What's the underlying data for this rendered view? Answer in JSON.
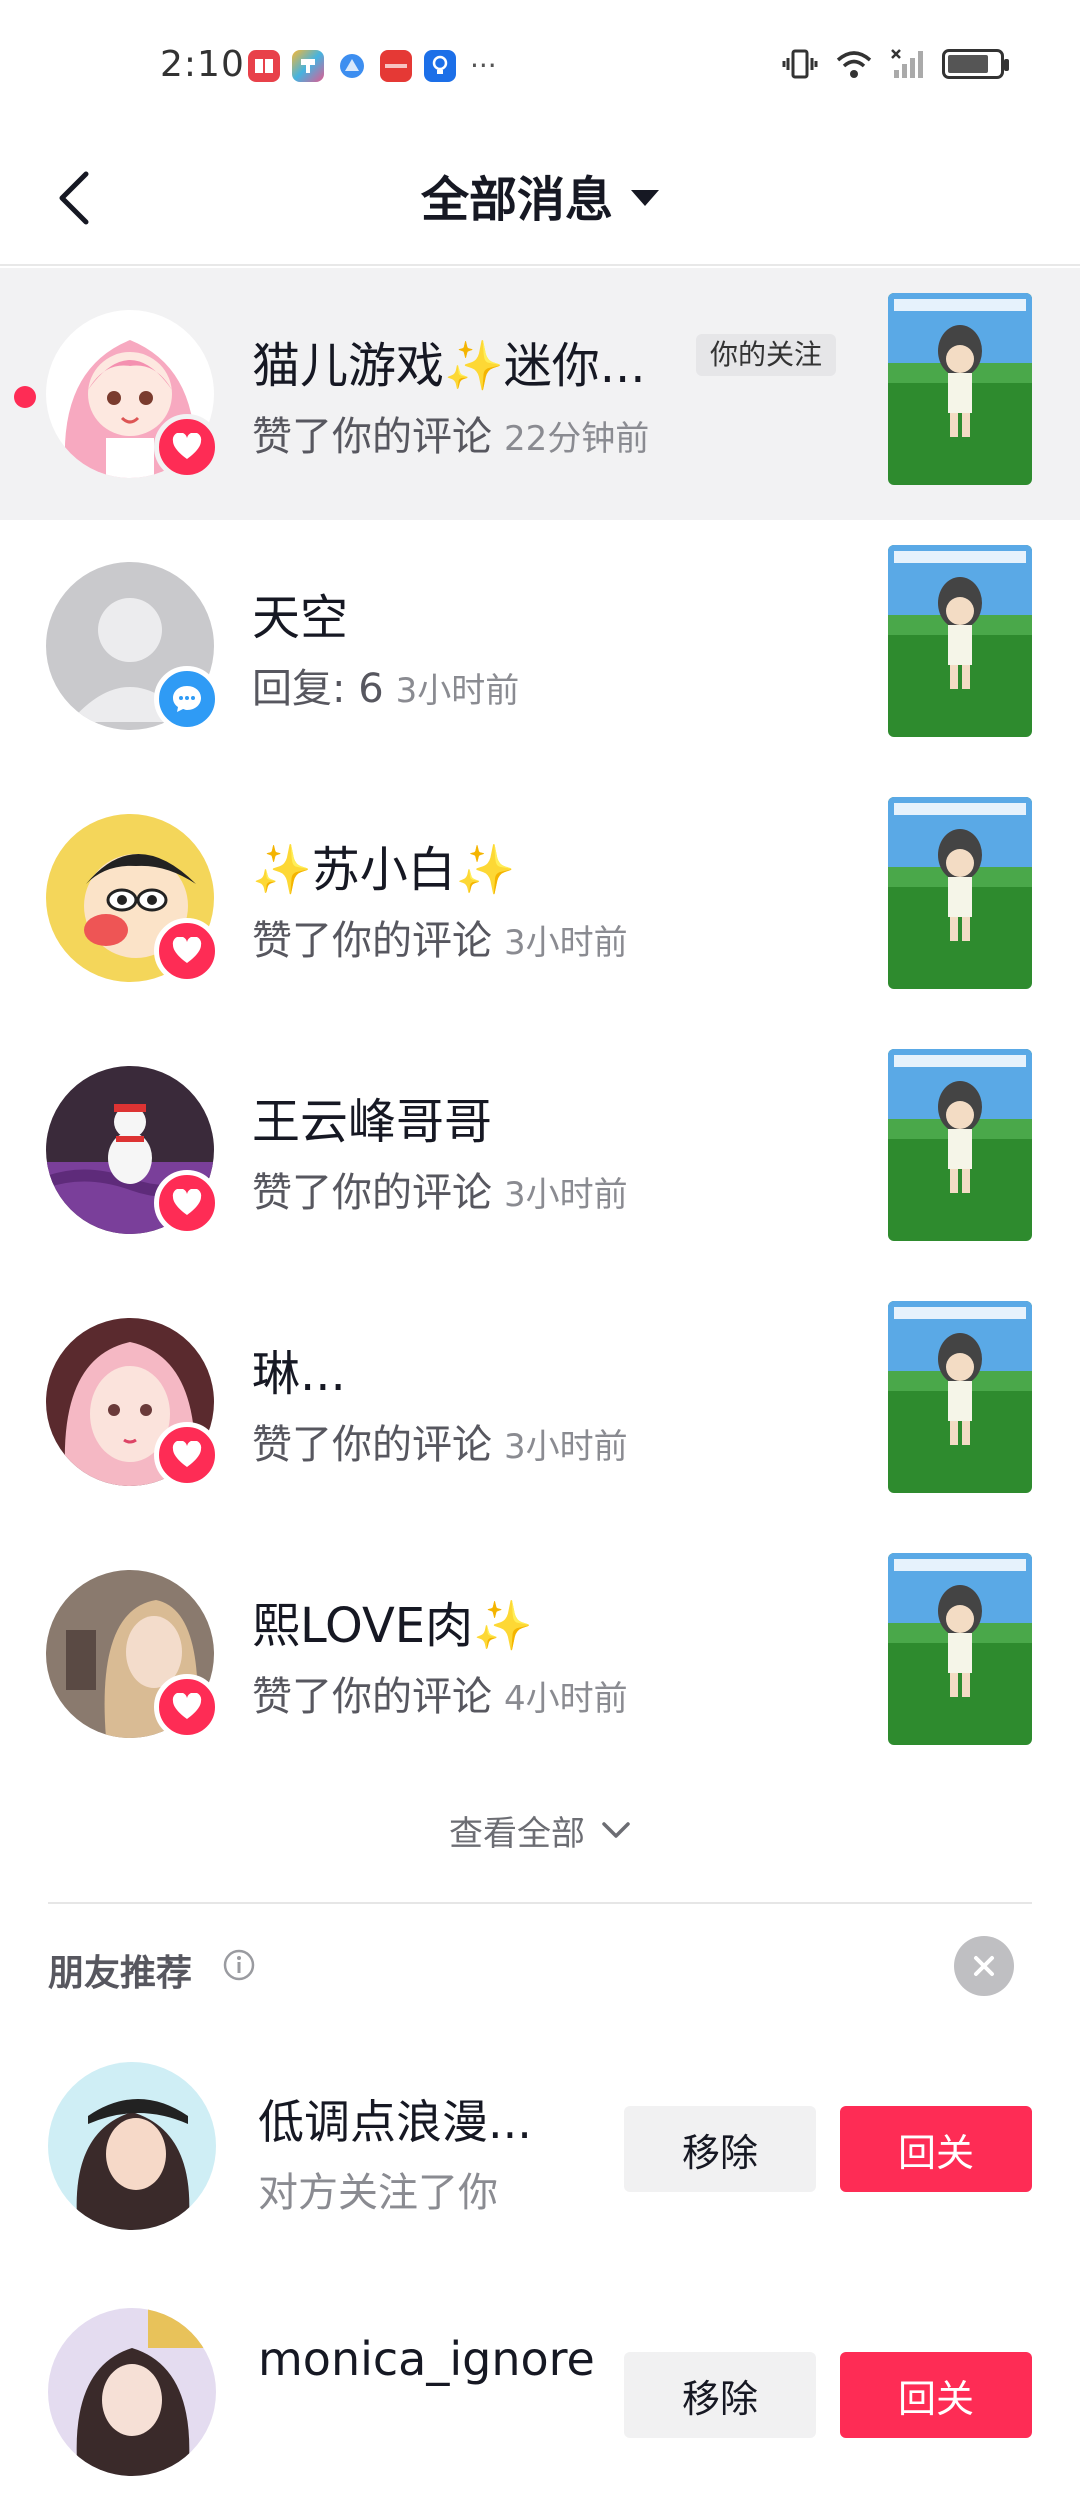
{
  "status_bar": {
    "time": "2:10",
    "notif_more": "···"
  },
  "header": {
    "title": "全部消息"
  },
  "messages": [
    {
      "name": "猫儿游戏✨迷你...",
      "tag": "你的关注",
      "action": "赞了你的评论",
      "time": "22分钟前",
      "type": "like",
      "unread": true
    },
    {
      "name": "天空",
      "action": "回复: 6",
      "time": "3小时前",
      "type": "reply"
    },
    {
      "name": "✨苏小白✨",
      "action": "赞了你的评论",
      "time": "3小时前",
      "type": "like"
    },
    {
      "name": "王云峰哥哥",
      "action": "赞了你的评论",
      "time": "3小时前",
      "type": "like"
    },
    {
      "name": "琳...",
      "action": "赞了你的评论",
      "time": "3小时前",
      "type": "like"
    },
    {
      "name": "熙LOVE肉✨",
      "action": "赞了你的评论",
      "time": "4小时前",
      "type": "like"
    }
  ],
  "view_all": "查看全部",
  "friends_section": {
    "title": "朋友推荐",
    "items": [
      {
        "name": "低调点浪漫...",
        "subtitle": "对方关注了你",
        "remove_label": "移除",
        "follow_label": "回关"
      },
      {
        "name": "monica_ignore",
        "subtitle": "",
        "remove_label": "移除",
        "follow_label": "回关"
      }
    ]
  },
  "colors": {
    "accent": "#fe2c55",
    "reply_badge": "#2f9bf5",
    "highlight_row": "#f2f2f3"
  }
}
